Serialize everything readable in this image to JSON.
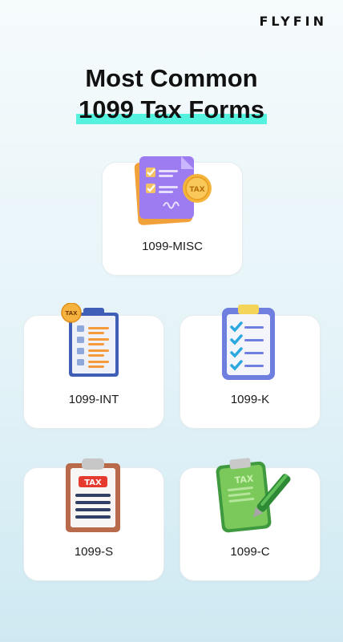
{
  "brand": {
    "logo": "FLYFIN"
  },
  "title": {
    "line1": "Most Common",
    "line2": "1099 Tax Forms"
  },
  "colors": {
    "highlight": "#55f2e0",
    "card_bg": "#ffffff"
  },
  "forms": [
    {
      "label": "1099-MISC",
      "icon": "document-checklist-tax-coin-icon"
    },
    {
      "label": "1099-INT",
      "icon": "clipboard-tax-badge-checklist-icon"
    },
    {
      "label": "1099-K",
      "icon": "clipboard-checkmarks-icon"
    },
    {
      "label": "1099-S",
      "icon": "clipboard-tax-label-icon"
    },
    {
      "label": "1099-C",
      "icon": "clipboard-tax-pen-icon"
    }
  ],
  "icon_text": {
    "tax": "TAX"
  }
}
